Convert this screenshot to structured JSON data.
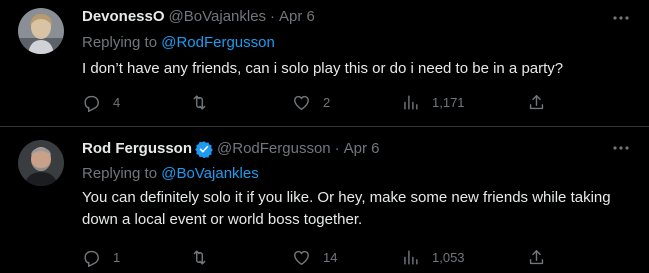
{
  "tweets": [
    {
      "display_name": "DevonessO",
      "handle": "@BoVajankles",
      "separator": "·",
      "date": "Apr 6",
      "verified": false,
      "replying_prefix": "Replying to ",
      "replying_to": "@RodFergusson",
      "text": "I don’t have any friends, can i solo play this or do i need to be in a party?",
      "replies": "4",
      "retweets": "",
      "likes": "2",
      "views": "1,171"
    },
    {
      "display_name": "Rod Fergusson",
      "handle": "@RodFergusson",
      "separator": "·",
      "date": "Apr 6",
      "verified": true,
      "replying_prefix": "Replying to ",
      "replying_to": "@BoVajankles",
      "text": "You can definitely solo it if you like. Or hey, make some new friends while taking down a local event or world boss together.",
      "replies": "1",
      "retweets": "",
      "likes": "14",
      "views": "1,053"
    }
  ],
  "icons": {
    "reply": "reply-icon",
    "retweet": "retweet-icon",
    "like": "heart-icon",
    "views": "views-icon",
    "share": "share-icon",
    "more": "more-icon",
    "verified": "verified-badge-icon"
  },
  "colors": {
    "background": "#000000",
    "text": "#e7e9ea",
    "muted": "#71767b",
    "link": "#1d9bf0",
    "divider": "#2f3336"
  }
}
